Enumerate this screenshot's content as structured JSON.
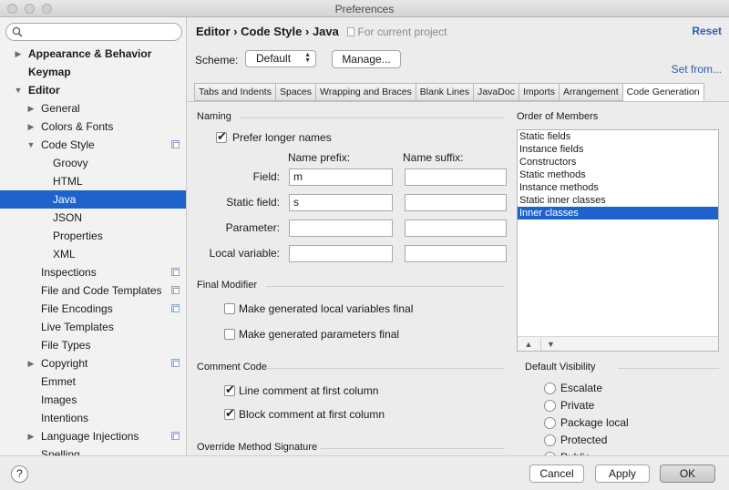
{
  "window": {
    "title": "Preferences"
  },
  "search": {
    "placeholder": ""
  },
  "sidebar": {
    "items": [
      {
        "label": "Appearance & Behavior",
        "level": 0,
        "arrow": "right",
        "bold": true
      },
      {
        "label": "Keymap",
        "level": 0,
        "arrow": "",
        "bold": true
      },
      {
        "label": "Editor",
        "level": 0,
        "arrow": "down",
        "bold": true
      },
      {
        "label": "General",
        "level": 1,
        "arrow": "right"
      },
      {
        "label": "Colors & Fonts",
        "level": 1,
        "arrow": "right"
      },
      {
        "label": "Code Style",
        "level": 1,
        "arrow": "down",
        "copy": true
      },
      {
        "label": "Groovy",
        "level": 2,
        "arrow": ""
      },
      {
        "label": "HTML",
        "level": 2,
        "arrow": ""
      },
      {
        "label": "Java",
        "level": 2,
        "arrow": "",
        "selected": true
      },
      {
        "label": "JSON",
        "level": 2,
        "arrow": ""
      },
      {
        "label": "Properties",
        "level": 2,
        "arrow": ""
      },
      {
        "label": "XML",
        "level": 2,
        "arrow": ""
      },
      {
        "label": "Inspections",
        "level": 1,
        "arrow": "",
        "copy": true
      },
      {
        "label": "File and Code Templates",
        "level": 1,
        "arrow": "",
        "copy": true
      },
      {
        "label": "File Encodings",
        "level": 1,
        "arrow": "",
        "copy": true
      },
      {
        "label": "Live Templates",
        "level": 1,
        "arrow": ""
      },
      {
        "label": "File Types",
        "level": 1,
        "arrow": ""
      },
      {
        "label": "Copyright",
        "level": 1,
        "arrow": "right",
        "copy": true
      },
      {
        "label": "Emmet",
        "level": 1,
        "arrow": ""
      },
      {
        "label": "Images",
        "level": 1,
        "arrow": ""
      },
      {
        "label": "Intentions",
        "level": 1,
        "arrow": ""
      },
      {
        "label": "Language Injections",
        "level": 1,
        "arrow": "right",
        "copy": true
      },
      {
        "label": "Spelling",
        "level": 1,
        "arrow": ""
      }
    ]
  },
  "header": {
    "crumb1": "Editor",
    "sep": "›",
    "crumb2": "Code Style",
    "crumb3": "Java",
    "project_note": "For current project",
    "reset": "Reset"
  },
  "scheme": {
    "label": "Scheme:",
    "value": "Default",
    "manage": "Manage...",
    "set_from": "Set from..."
  },
  "tabs": [
    {
      "label": "Tabs and Indents"
    },
    {
      "label": "Spaces"
    },
    {
      "label": "Wrapping and Braces"
    },
    {
      "label": "Blank Lines"
    },
    {
      "label": "JavaDoc"
    },
    {
      "label": "Imports"
    },
    {
      "label": "Arrangement"
    },
    {
      "label": "Code Generation",
      "active": true
    }
  ],
  "naming": {
    "title": "Naming",
    "prefer_longer": "Prefer longer names",
    "prefer_longer_checked": true,
    "prefix_header": "Name prefix:",
    "suffix_header": "Name suffix:",
    "rows": [
      {
        "label": "Field:",
        "prefix": "m",
        "suffix": ""
      },
      {
        "label": "Static field:",
        "prefix": "s",
        "suffix": ""
      },
      {
        "label": "Parameter:",
        "prefix": "",
        "suffix": ""
      },
      {
        "label": "Local variable:",
        "prefix": "",
        "suffix": ""
      }
    ]
  },
  "final_modifier": {
    "title": "Final Modifier",
    "local_vars": "Make generated local variables final",
    "local_vars_checked": false,
    "params": "Make generated parameters final",
    "params_checked": false
  },
  "comment_code": {
    "title": "Comment Code",
    "line_comment": "Line comment at first column",
    "line_comment_checked": true,
    "block_comment": "Block comment at first column",
    "block_comment_checked": true
  },
  "override": {
    "title": "Override Method Signature"
  },
  "order": {
    "title": "Order of Members",
    "items": [
      "Static fields",
      "Instance fields",
      "Constructors",
      "Static methods",
      "Instance methods",
      "Static inner classes",
      "Inner classes"
    ],
    "selected_index": 6,
    "up_glyph": "▲",
    "down_glyph": "▼"
  },
  "visibility": {
    "title": "Default Visibility",
    "options": [
      "Escalate",
      "Private",
      "Package local",
      "Protected",
      "Public"
    ]
  },
  "footer": {
    "help": "?",
    "cancel": "Cancel",
    "apply": "Apply",
    "ok": "OK"
  },
  "colors": {
    "selection": "#1d63cb",
    "link": "#2b5fad"
  }
}
